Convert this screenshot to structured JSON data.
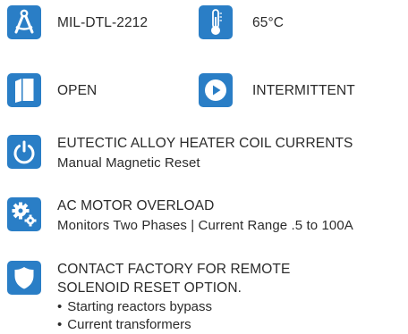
{
  "colors": {
    "tile": "#2a7ec6",
    "text": "#2b2b2b"
  },
  "specs": [
    {
      "icon": "compass-drafting-icon",
      "text": "MIL-DTL-2212"
    },
    {
      "icon": "thermometer-icon",
      "text": "65°C"
    },
    {
      "icon": "enclosure-box-icon",
      "text": "OPEN"
    },
    {
      "icon": "play-circle-icon",
      "text": "INTERMITTENT"
    }
  ],
  "features": [
    {
      "icon": "power-icon",
      "title": "EUTECTIC ALLOY HEATER COIL CURRENTS",
      "detail": "Manual Magnetic Reset"
    },
    {
      "icon": "gears-icon",
      "title": "AC MOTOR OVERLOAD",
      "detail": "Monitors Two Phases | Current Range .5 to 100A"
    },
    {
      "icon": "shield-icon",
      "title_lines": [
        "CONTACT FACTORY FOR REMOTE",
        "SOLENOID RESET OPTION."
      ],
      "bullets": [
        "Starting reactors bypass",
        "Current transformers"
      ]
    }
  ]
}
